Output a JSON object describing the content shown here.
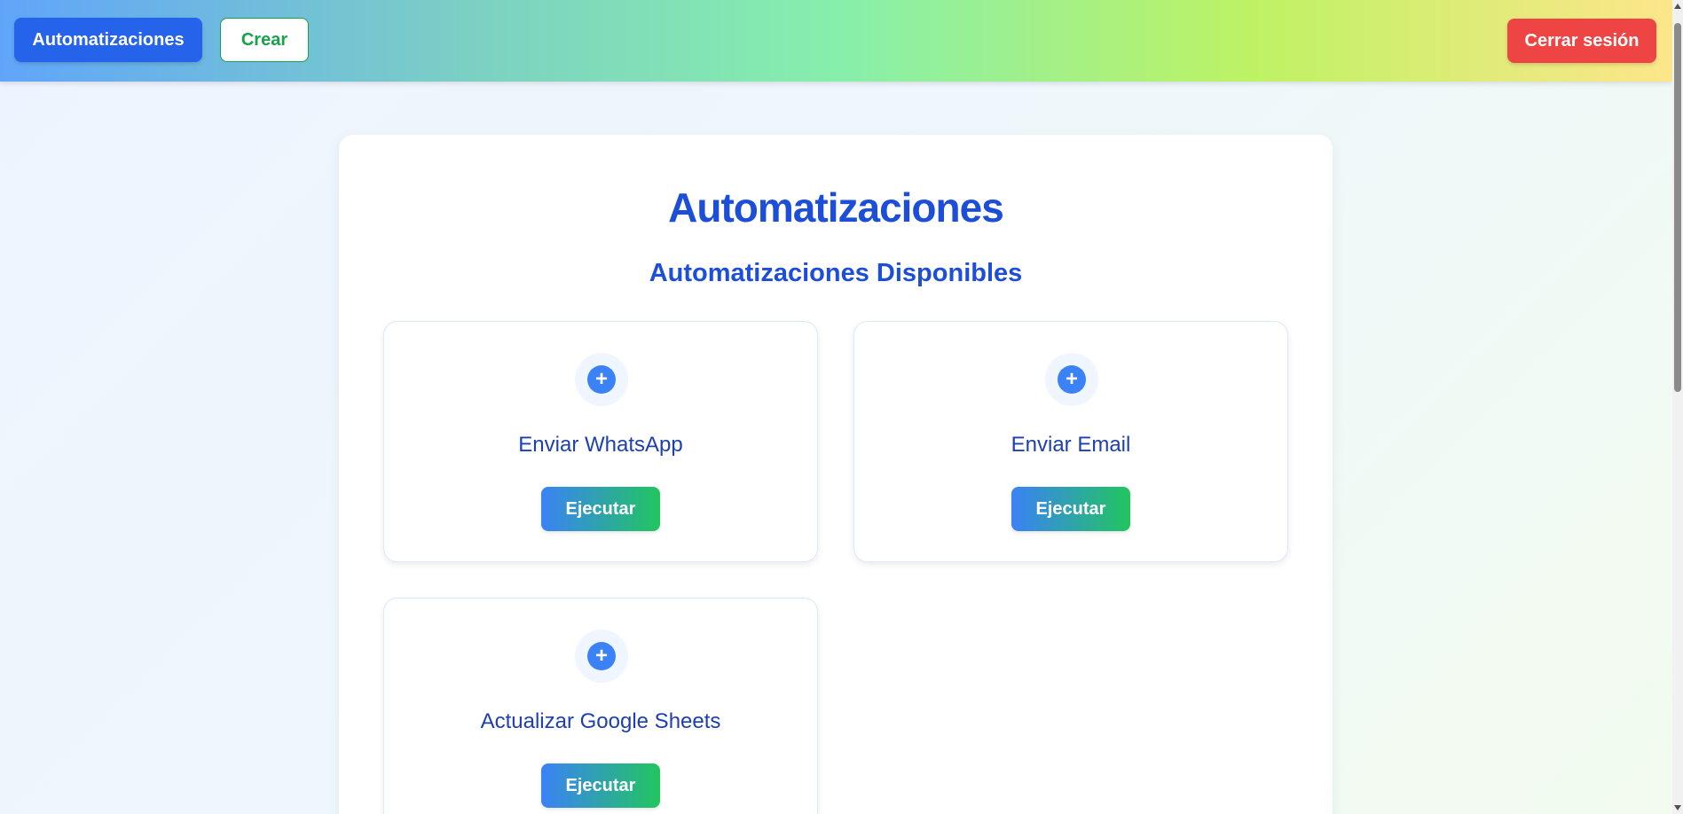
{
  "navbar": {
    "automatizaciones_label": "Automatizaciones",
    "crear_label": "Crear",
    "logout_label": "Cerrar sesión"
  },
  "main": {
    "title": "Automatizaciones",
    "section_title": "Automatizaciones Disponibles",
    "cards": [
      {
        "name": "Enviar WhatsApp",
        "button_label": "Ejecutar",
        "icon": "plus-icon"
      },
      {
        "name": "Enviar Email",
        "button_label": "Ejecutar",
        "icon": "plus-icon"
      },
      {
        "name": "Actualizar Google Sheets",
        "button_label": "Ejecutar",
        "icon": "plus-icon"
      }
    ]
  },
  "colors": {
    "primary": "#2563eb",
    "success": "#16a34a",
    "danger": "#ef4444",
    "title": "#1d4ed8"
  }
}
